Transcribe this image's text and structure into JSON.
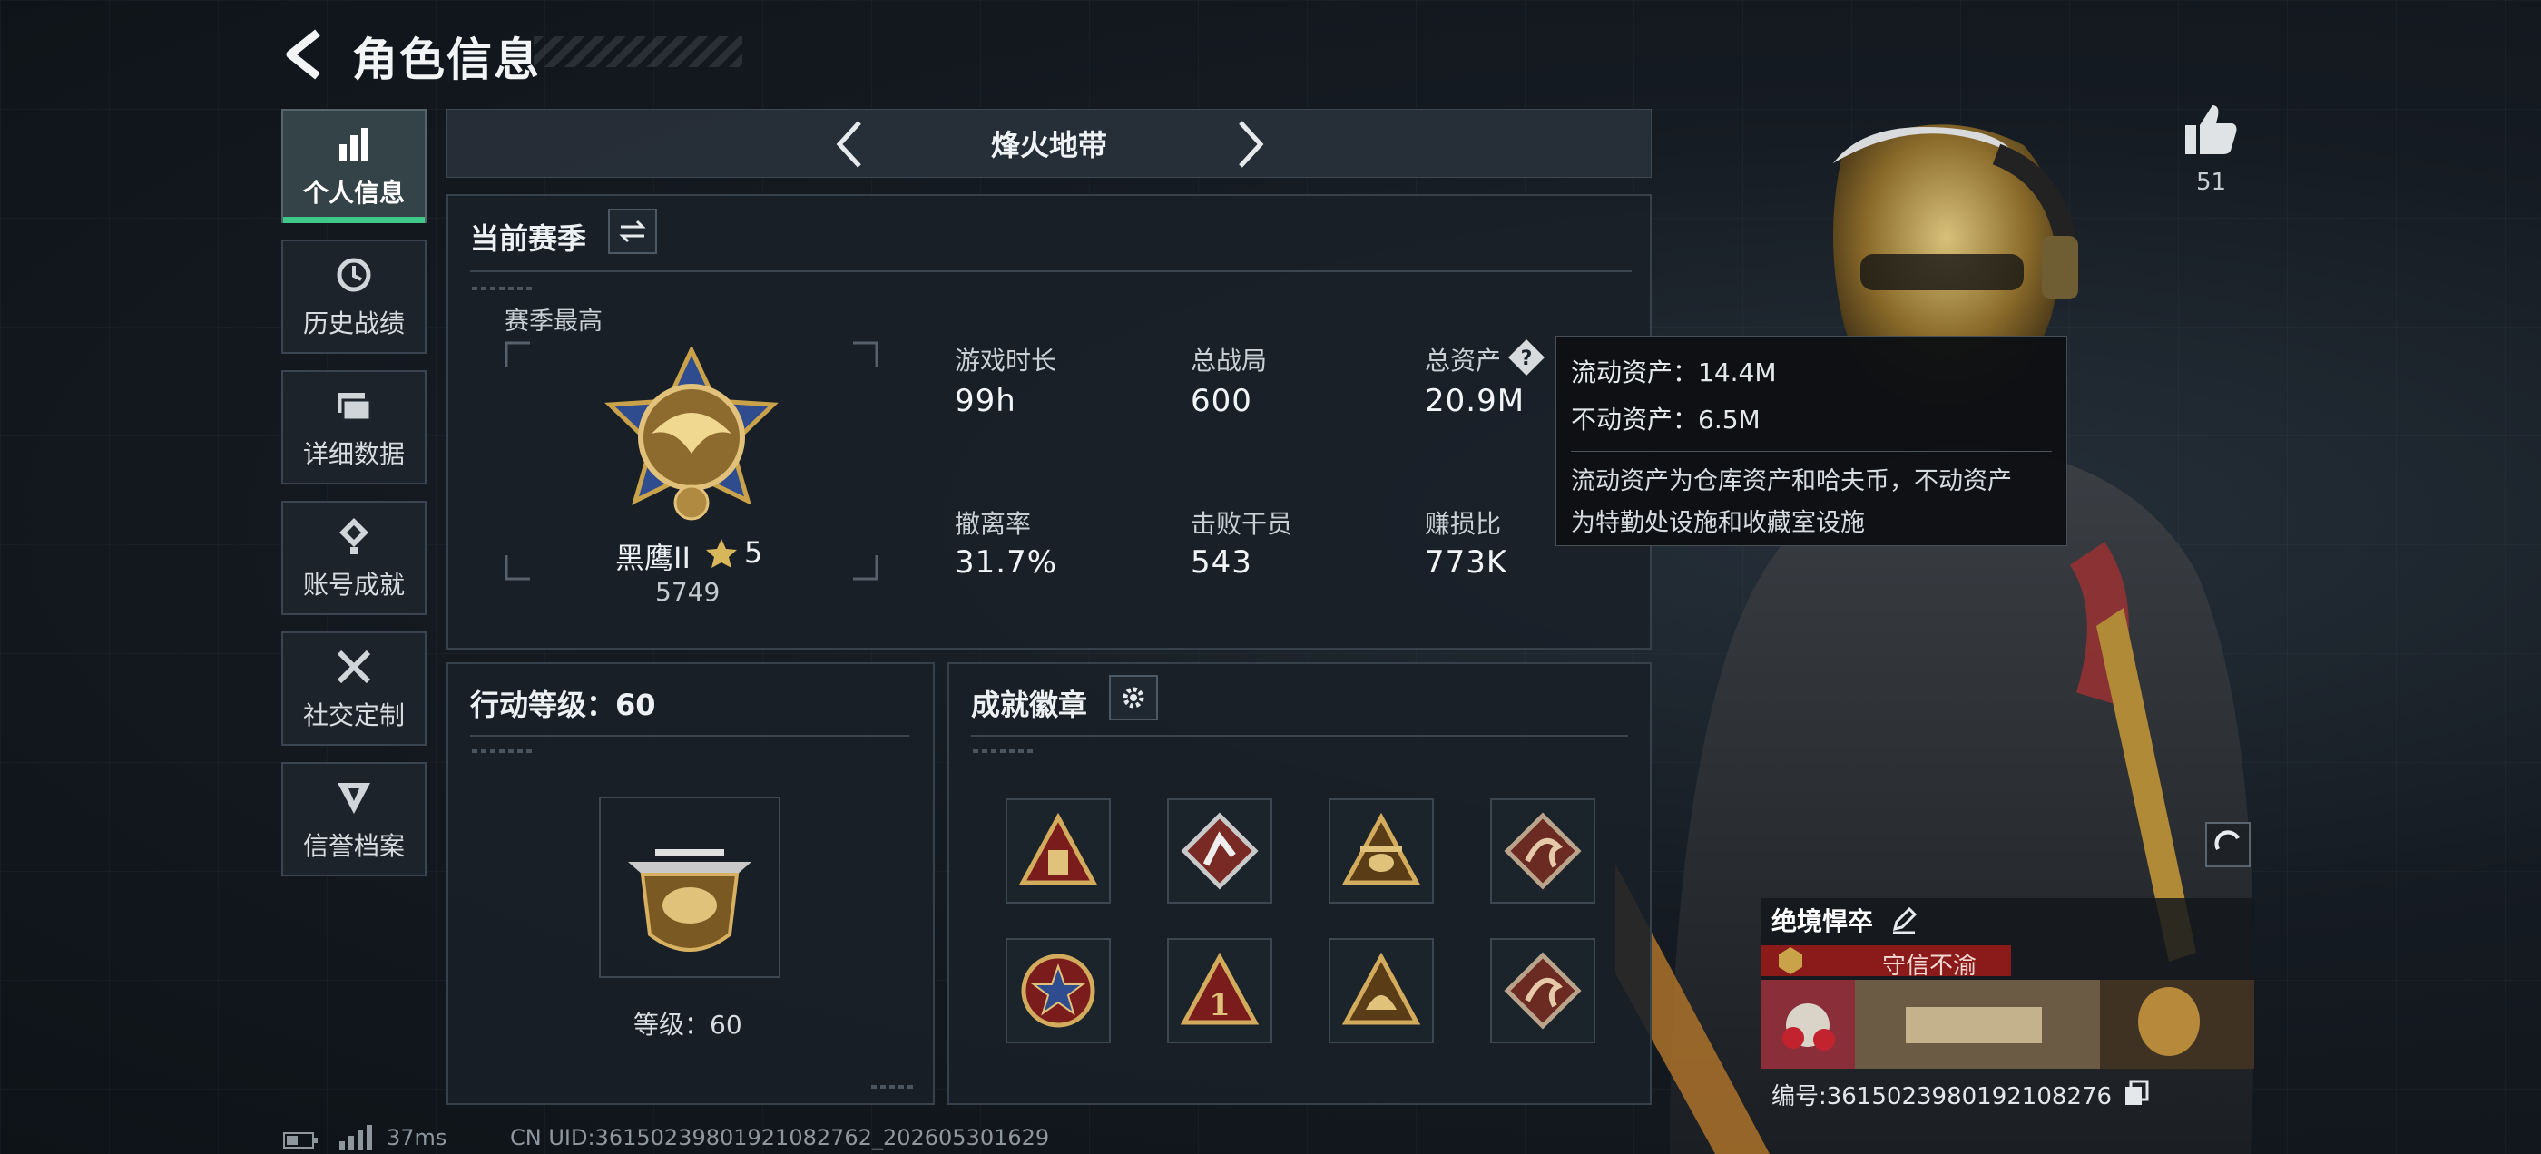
{
  "header": {
    "title": "角色信息"
  },
  "sidebar": {
    "items": [
      {
        "label": "个人信息",
        "icon": "bar-chart-icon",
        "active": true
      },
      {
        "label": "历史战绩",
        "icon": "history-icon"
      },
      {
        "label": "详细数据",
        "icon": "folder-icon"
      },
      {
        "label": "账号成就",
        "icon": "achievement-icon"
      },
      {
        "label": "社交定制",
        "icon": "tools-icon"
      },
      {
        "label": "信誉档案",
        "icon": "reputation-icon"
      }
    ]
  },
  "mode": {
    "name": "烽火地带"
  },
  "season": {
    "title": "当前赛季",
    "best_label": "赛季最高",
    "rank_name": "黑鹰II",
    "rank_stars": "5",
    "rank_score": "5749"
  },
  "stats": [
    {
      "label": "游戏时长",
      "value": "99h"
    },
    {
      "label": "总战局",
      "value": "600"
    },
    {
      "label": "总资产",
      "value": "20.9M"
    },
    {
      "label": "撤离率",
      "value": "31.7%"
    },
    {
      "label": "击败干员",
      "value": "543"
    },
    {
      "label": "赚损比",
      "value": "773K"
    }
  ],
  "tooltip": {
    "liquid": "流动资产：14.4M",
    "fixed": "不动资产：6.5M",
    "desc_line1": "流动资产为仓库资产和哈夫币，不动资产",
    "desc_line2": "为特勤处设施和收藏室设施"
  },
  "action_level": {
    "title": "行动等级：60",
    "level_text": "等级：60"
  },
  "badges": {
    "title": "成就徽章",
    "items": [
      "badge-1",
      "badge-2",
      "badge-3",
      "badge-4",
      "badge-5",
      "badge-6",
      "badge-7",
      "badge-8"
    ]
  },
  "like": {
    "count": "51"
  },
  "card": {
    "name": "绝境悍卒",
    "motto": "守信不渝",
    "uid_line": "编号:3615023980192108276"
  },
  "status": {
    "ping": "37ms",
    "uid": "CN UID:3615023980192108276​2_202605301629"
  },
  "colors": {
    "accent": "#3ec88a",
    "motto_bg": "#8b1a1a",
    "gold": "#c9a24a"
  }
}
